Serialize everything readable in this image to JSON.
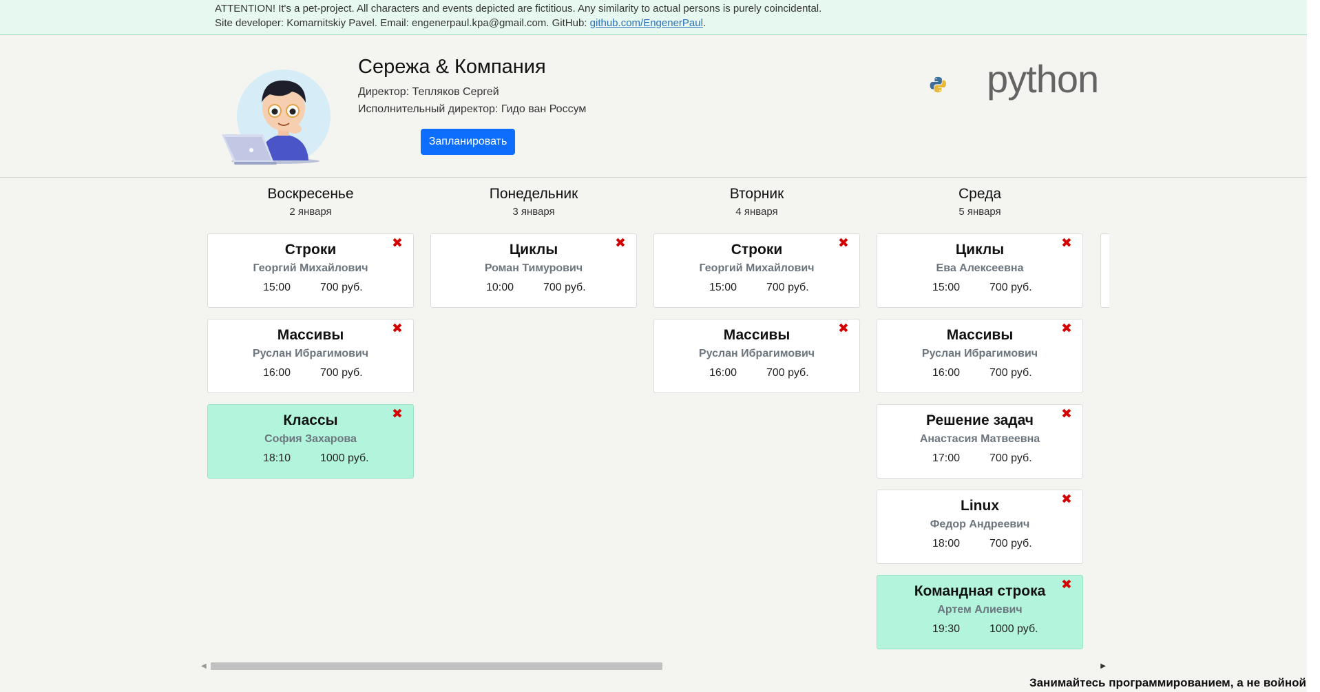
{
  "notice": {
    "line1": "ATTENTION! It's a pet-project. All characters and events depicted are fictitious. Any similarity to actual persons is purely coincidental.",
    "line2_prefix": "Site developer: Komarnitskiy Pavel. Email: engenerpaul.kpa@gmail.com. GitHub: ",
    "github_link": "github.com/EngenerPaul",
    "line2_suffix": "."
  },
  "header": {
    "company": "Сережа & Компания",
    "director": "Директор: Тепляков Сергей",
    "exec_director": "Исполнительный директор: Гидо ван Россум",
    "plan_button": "Запланировать",
    "python_logo_text": "python"
  },
  "days": [
    {
      "name": "Воскресенье",
      "date": "2 января",
      "lessons": [
        {
          "title": "Строки",
          "teacher": "Георгий Михайлович",
          "time": "15:00",
          "price": "700 руб.",
          "paid": false
        },
        {
          "title": "Массивы",
          "teacher": "Руслан Ибрагимович",
          "time": "16:00",
          "price": "700 руб.",
          "paid": false
        },
        {
          "title": "Классы",
          "teacher": "София Захарова",
          "time": "18:10",
          "price": "1000 руб.",
          "paid": true
        }
      ]
    },
    {
      "name": "Понедельник",
      "date": "3 января",
      "lessons": [
        {
          "title": "Циклы",
          "teacher": "Роман Тимурович",
          "time": "10:00",
          "price": "700 руб.",
          "paid": false
        }
      ]
    },
    {
      "name": "Вторник",
      "date": "4 января",
      "lessons": [
        {
          "title": "Строки",
          "teacher": "Георгий Михайлович",
          "time": "15:00",
          "price": "700 руб.",
          "paid": false
        },
        {
          "title": "Массивы",
          "teacher": "Руслан Ибрагимович",
          "time": "16:00",
          "price": "700 руб.",
          "paid": false
        }
      ]
    },
    {
      "name": "Среда",
      "date": "5 января",
      "lessons": [
        {
          "title": "Циклы",
          "teacher": "Ева Алексеевна",
          "time": "15:00",
          "price": "700 руб.",
          "paid": false
        },
        {
          "title": "Массивы",
          "teacher": "Руслан Ибрагимович",
          "time": "16:00",
          "price": "700 руб.",
          "paid": false
        },
        {
          "title": "Решение задач",
          "teacher": "Анастасия Матвеевна",
          "time": "17:00",
          "price": "700 руб.",
          "paid": false
        },
        {
          "title": "Linux",
          "teacher": "Федор Андреевич",
          "time": "18:00",
          "price": "700 руб.",
          "paid": false
        },
        {
          "title": "Командная строка",
          "teacher": "Артем Алиевич",
          "time": "19:30",
          "price": "1000 руб.",
          "paid": true
        }
      ]
    }
  ],
  "delete_icon": "✖",
  "footer": "Занимайтесь программированием, а не войной",
  "colors": {
    "accent": "#0d6efd",
    "paid_card": "#b3f5dc",
    "delete": "#d40000",
    "notice_bg": "#e6f8ef"
  }
}
